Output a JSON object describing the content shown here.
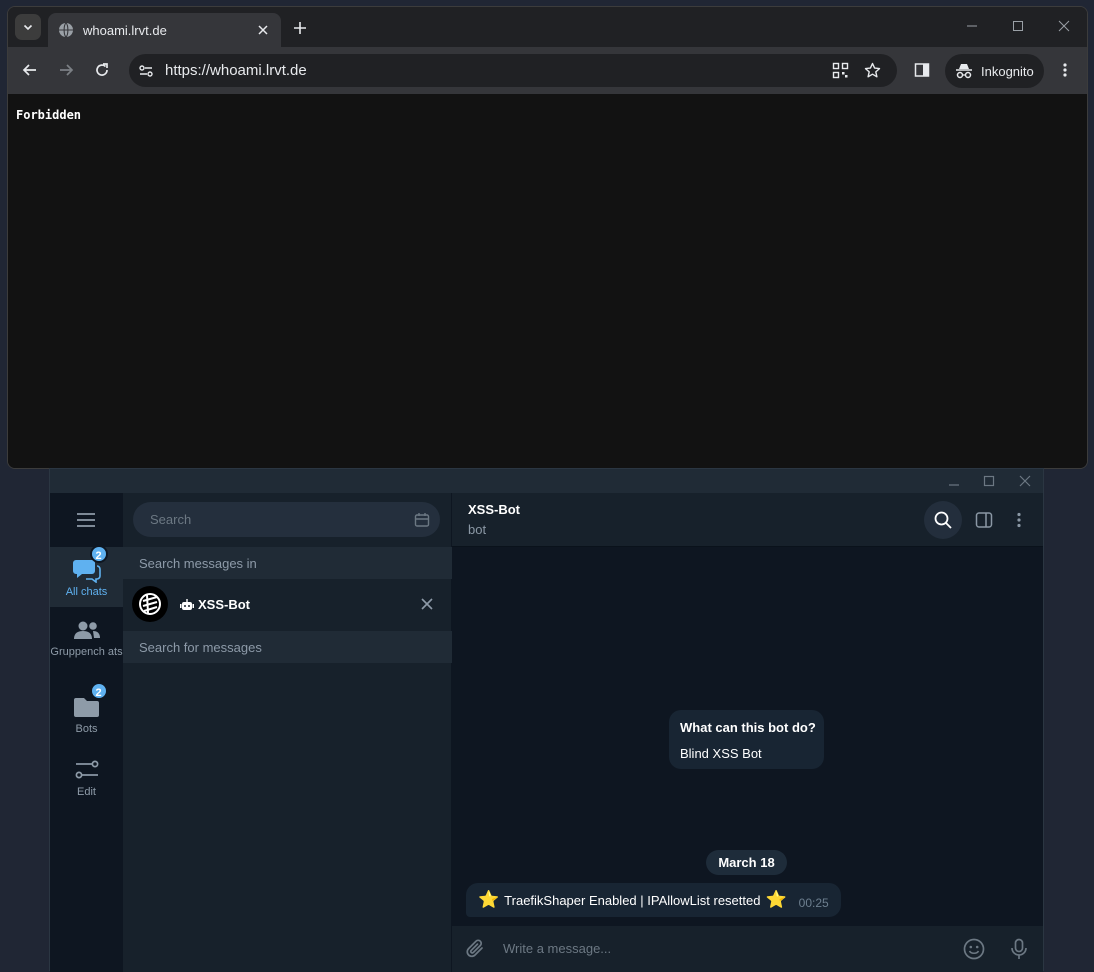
{
  "browser": {
    "tab_title": "whoami.lrvt.de",
    "url": "https://whoami.lrvt.de",
    "incognito_label": "Inkognito",
    "page_text": "Forbidden",
    "icons": [
      "tab-search-icon",
      "globe-icon",
      "close-icon",
      "plus-icon",
      "minimize-icon",
      "maximize-icon",
      "back-icon",
      "forward-icon",
      "reload-icon",
      "site-settings-icon",
      "qr-code-icon",
      "star-icon",
      "side-panel-icon",
      "incognito-icon",
      "more-vert-icon"
    ]
  },
  "telegram": {
    "rail": {
      "items": [
        {
          "label": "All chats",
          "badge": "2"
        },
        {
          "label": "Gruppench ats"
        },
        {
          "label": "Bots",
          "badge": "2"
        },
        {
          "label": "Edit"
        }
      ]
    },
    "search": {
      "placeholder": "Search"
    },
    "search_in_label": "Search messages in",
    "chat": {
      "name": "XSS-Bot"
    },
    "search_for_label": "Search for messages",
    "header": {
      "title": "XSS-Bot",
      "status": "bot"
    },
    "bot_info": {
      "title": "What can this bot do?",
      "text": "Blind XSS Bot"
    },
    "date_label": "March 18",
    "message": {
      "text": "TraefikShaper Enabled | IPAllowList resetted",
      "prefix_emoji": "⭐",
      "suffix_emoji": "⭐",
      "time": "00:25"
    },
    "compose": {
      "placeholder": "Write a message..."
    },
    "accent_color": "#5fb1f0"
  }
}
